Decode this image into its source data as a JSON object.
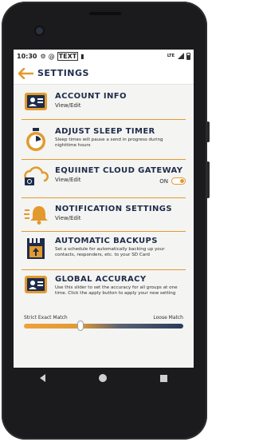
{
  "status_bar": {
    "time": "10:30",
    "txt_badge": "TEXT",
    "network": "LTE"
  },
  "header": {
    "title": "SETTINGS"
  },
  "settings": [
    {
      "title": "ACCOUNT INFO",
      "subtitle": "View/Edit",
      "icon": "account-card-icon"
    },
    {
      "title": "ADJUST SLEEP TIMER",
      "description": "Sleep times will pause a send in progress during nighttime hours",
      "icon": "stopwatch-icon"
    },
    {
      "title": "EQUIINET CLOUD GATEWAY",
      "subtitle": "View/Edit",
      "icon": "cloud-gateway-icon",
      "toggle_label": "ON",
      "toggle_on": true
    },
    {
      "title": "NOTIFICATION SETTINGS",
      "subtitle": "View/Edit",
      "icon": "bell-icon"
    },
    {
      "title": "AUTOMATIC BACKUPS",
      "description": "Set a schedule for automatically backing up your contacts, responders, etc. to your SD Card",
      "icon": "sd-backup-icon"
    },
    {
      "title": "GLOBAL ACCURACY",
      "description": "Use this slider to set the accuracy for all groups at one time. Click the apply button to apply your new setting",
      "icon": "accuracy-card-icon"
    }
  ],
  "accuracy_slider": {
    "min_label": "Strict Exact Match",
    "max_label": "Loose Match",
    "value": 0.35
  },
  "colors": {
    "accent": "#e29a2e",
    "navy": "#1e2b4a",
    "background": "#f4f4f2"
  }
}
